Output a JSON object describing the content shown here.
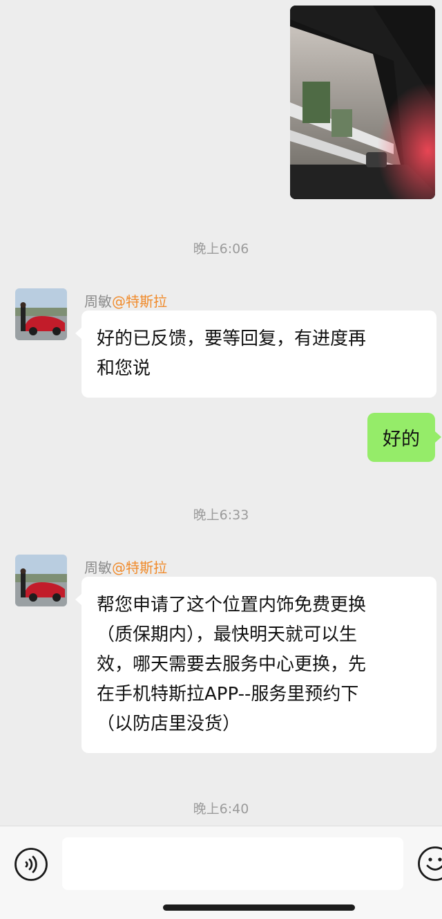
{
  "timestamps": [
    "晚上6:06",
    "晚上6:33",
    "晚上6:40"
  ],
  "messages": [
    {
      "sender": "周敏",
      "org": "@特斯拉",
      "text_lines": [
        "好的已反馈，要等回复，有进度再",
        "和您说"
      ]
    },
    {
      "from_me": true,
      "text": "好的"
    },
    {
      "sender": "周敏",
      "org": "@特斯拉",
      "text_lines": [
        "帮您申请了这个位置内饰免费更换",
        "（质保期内），最快明天就可以生",
        "效，哪天需要去服务中心更换，先",
        "在手机特斯拉APP--服务里预约下",
        "（以防店里没货）"
      ]
    }
  ],
  "colors": {
    "background": "#ededed",
    "incoming_bubble": "#ffffff",
    "outgoing_bubble": "#95ec69",
    "org_tag": "#f08a2a",
    "timestamp": "#9b9b9b"
  },
  "icons": {
    "voice": "voice-icon",
    "emoji": "emoji-icon",
    "avatar_image": "red-car-avatar",
    "sent_photo": "car-interior-photo"
  }
}
